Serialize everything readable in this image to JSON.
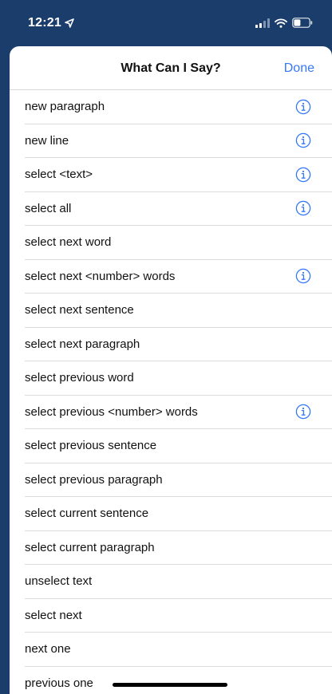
{
  "status_bar": {
    "time": "12:21",
    "location_icon": "location-arrow-icon",
    "signal_icon": "cellular-signal-icon",
    "wifi_icon": "wifi-icon",
    "battery_icon": "battery-icon"
  },
  "sheet": {
    "title": "What Can I Say?",
    "done_label": "Done"
  },
  "commands": [
    {
      "label": "new paragraph",
      "has_info": true
    },
    {
      "label": "new line",
      "has_info": true
    },
    {
      "label": "select <text>",
      "has_info": true
    },
    {
      "label": "select all",
      "has_info": true
    },
    {
      "label": "select next word",
      "has_info": false
    },
    {
      "label": "select next <number> words",
      "has_info": true
    },
    {
      "label": "select next sentence",
      "has_info": false
    },
    {
      "label": "select next paragraph",
      "has_info": false
    },
    {
      "label": "select previous word",
      "has_info": false
    },
    {
      "label": "select previous <number> words",
      "has_info": true
    },
    {
      "label": "select previous sentence",
      "has_info": false
    },
    {
      "label": "select previous paragraph",
      "has_info": false
    },
    {
      "label": "select current sentence",
      "has_info": false
    },
    {
      "label": "select current paragraph",
      "has_info": false
    },
    {
      "label": "unselect text",
      "has_info": false
    },
    {
      "label": "select next",
      "has_info": false
    },
    {
      "label": "next one",
      "has_info": false
    },
    {
      "label": "previous one",
      "has_info": false
    }
  ],
  "colors": {
    "accent": "#3478f6",
    "status_bar_bg": "#1b3d6b",
    "sheet_bg": "#ffffff",
    "separator": "#dcdcdf"
  }
}
